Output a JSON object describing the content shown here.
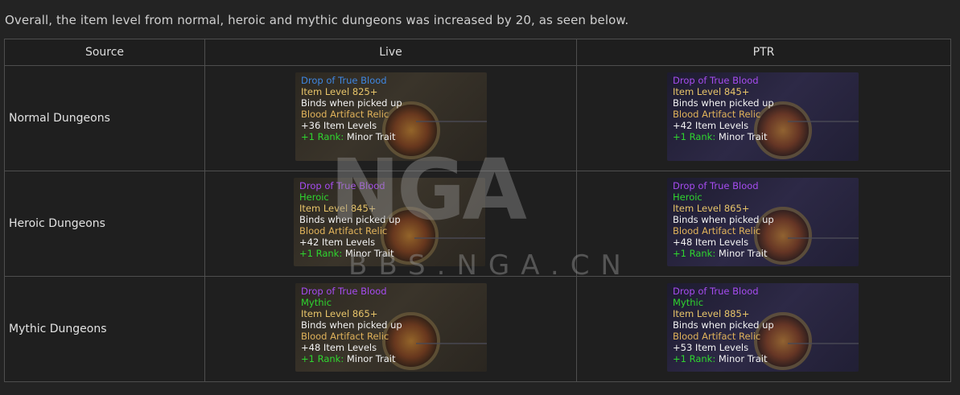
{
  "intro_text": "Overall, the item level from normal, heroic and mythic dungeons was increased by 20, as seen below.",
  "headers": {
    "source": "Source",
    "live": "Live",
    "ptr": "PTR"
  },
  "rows": [
    {
      "source": "Normal Dungeons",
      "live": {
        "name": "Drop of True Blood",
        "difficulty": "",
        "item_level": "Item Level 825+",
        "binds": "Binds when picked up",
        "relic": "Blood Artifact Relic",
        "bonus": "+36 Item Levels",
        "rank_prefix": "+1 Rank:",
        "rank_trait": "Minor Trait"
      },
      "ptr": {
        "name": "Drop of True Blood",
        "difficulty": "",
        "item_level": "Item Level 845+",
        "binds": "Binds when picked up",
        "relic": "Blood Artifact Relic",
        "bonus": "+42 Item Levels",
        "rank_prefix": "+1 Rank:",
        "rank_trait": "Minor Trait"
      }
    },
    {
      "source": "Heroic Dungeons",
      "live": {
        "name": "Drop of True Blood",
        "difficulty": "Heroic",
        "item_level": "Item Level 845+",
        "binds": "Binds when picked up",
        "relic": "Blood Artifact Relic",
        "bonus": "+42 Item Levels",
        "rank_prefix": "+1 Rank:",
        "rank_trait": "Minor Trait"
      },
      "ptr": {
        "name": "Drop of True Blood",
        "difficulty": "Heroic",
        "item_level": "Item Level 865+",
        "binds": "Binds when picked up",
        "relic": "Blood Artifact Relic",
        "bonus": "+48 Item Levels",
        "rank_prefix": "+1 Rank:",
        "rank_trait": "Minor Trait"
      }
    },
    {
      "source": "Mythic Dungeons",
      "live": {
        "name": "Drop of True Blood",
        "difficulty": "Mythic",
        "item_level": "Item Level 865+",
        "binds": "Binds when picked up",
        "relic": "Blood Artifact Relic",
        "bonus": "+48 Item Levels",
        "rank_prefix": "+1 Rank:",
        "rank_trait": "Minor Trait"
      },
      "ptr": {
        "name": "Drop of True Blood",
        "difficulty": "Mythic",
        "item_level": "Item Level 885+",
        "binds": "Binds when picked up",
        "relic": "Blood Artifact Relic",
        "bonus": "+53 Item Levels",
        "rank_prefix": "+1 Rank:",
        "rank_trait": "Minor Trait"
      }
    }
  ],
  "watermark": {
    "logo": "NGA",
    "site": "BBS.NGA.CN"
  },
  "colors": {
    "rare_blue": "#3f86e0",
    "epic_purple": "#a64cf0",
    "gold": "#e8c56a",
    "green": "#2fd52f"
  }
}
